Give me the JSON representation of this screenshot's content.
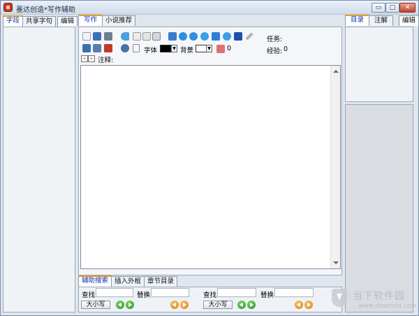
{
  "window": {
    "title": "墨达创造*写作辅助",
    "minimize_glyph": "▭",
    "maximize_glyph": "□",
    "close_glyph": "✕"
  },
  "left_panel": {
    "tabs": [
      "字段",
      "共享字句",
      "编辑"
    ]
  },
  "center": {
    "tabs": [
      "写作",
      "小说推荐"
    ],
    "font_label": "字体",
    "background_label": "背景",
    "count_value": "0",
    "note_label": "注释:",
    "task_label": "任务:",
    "exp_label": "经验:",
    "exp_value": "0",
    "text_color": "#000000",
    "bg_color": "#ffffff",
    "minus_glyph": "-",
    "plus_glyph": "-"
  },
  "bottom": {
    "tabs": [
      "辅助搜索",
      "插入外框",
      "章节目录"
    ],
    "find_label": "查找",
    "replace_label": "替换",
    "case_label": "大小写",
    "find_value": "",
    "replace_value": "",
    "find2_value": "",
    "replace2_value": ""
  },
  "right_panel": {
    "tabs": [
      "目录",
      "注解",
      "编辑"
    ]
  },
  "watermark": {
    "cn": "当下软件园",
    "en": "www.downxia.com"
  },
  "colors": {
    "accent": "#1230b0",
    "active_tab_border": "#e8a020"
  }
}
